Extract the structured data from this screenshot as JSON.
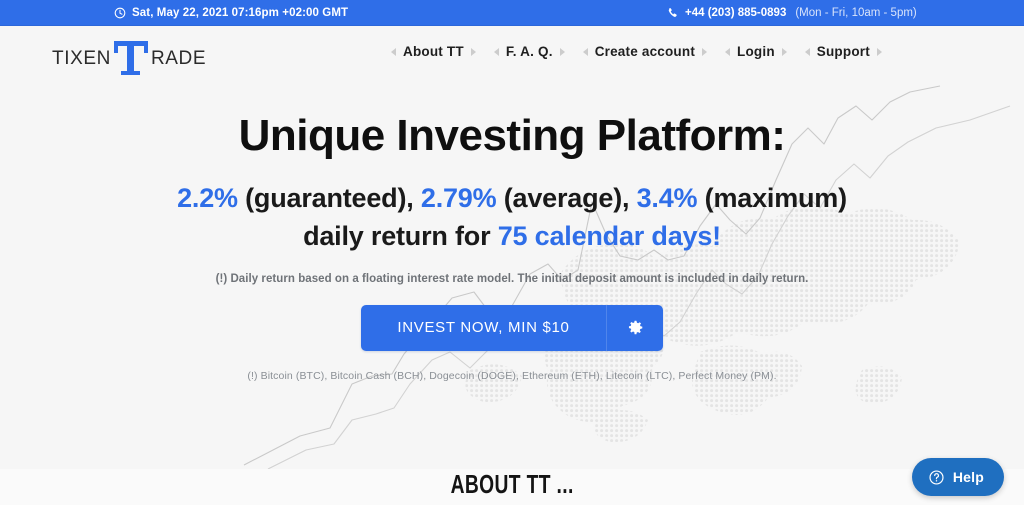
{
  "topbar": {
    "clock_icon": "clock-icon",
    "datetime": "Sat, May 22, 2021 07:16pm +02:00 GMT",
    "phone_icon": "phone-icon",
    "phone_number": "+44 (203) 885-0893",
    "phone_hours": "(Mon - Fri, 10am - 5pm)",
    "background_color": "#2f6ee8"
  },
  "header": {
    "logo": {
      "left_text": "TIXEN",
      "mark": "T",
      "right_text": "RADE",
      "mark_color": "#2f6ee8"
    },
    "nav": [
      {
        "label": "About TT"
      },
      {
        "label": "F. A. Q."
      },
      {
        "label": "Create account"
      },
      {
        "label": "Login"
      },
      {
        "label": "Support"
      }
    ]
  },
  "hero": {
    "headline": "Unique Investing Platform:",
    "rate_guaranteed": "2.2%",
    "rate_guaranteed_suffix": " (guaranteed), ",
    "rate_average": "2.79%",
    "rate_average_suffix": " (average), ",
    "rate_maximum": "3.4%",
    "rate_maximum_suffix": " (maximum)",
    "daily_prefix": "daily return for ",
    "term": "75 calendar days!",
    "note": "(!) Daily return based on a floating interest rate model. The initial deposit amount is included in daily return.",
    "cta_label": "INVEST NOW, MIN $10",
    "cta_gear_icon": "gear-icon",
    "methods": "(!) Bitcoin (BTC), Bitcoin Cash (BCH), Dogecoin (DOGE), Ethereum (ETH), Litecoin (LTC), Perfect Money (PM).",
    "accent_color": "#2f6ee8"
  },
  "about": {
    "title": "ABOUT TT ..."
  },
  "help": {
    "icon": "question-circle-icon",
    "label": "Help",
    "background_color": "#1f6fc0"
  }
}
